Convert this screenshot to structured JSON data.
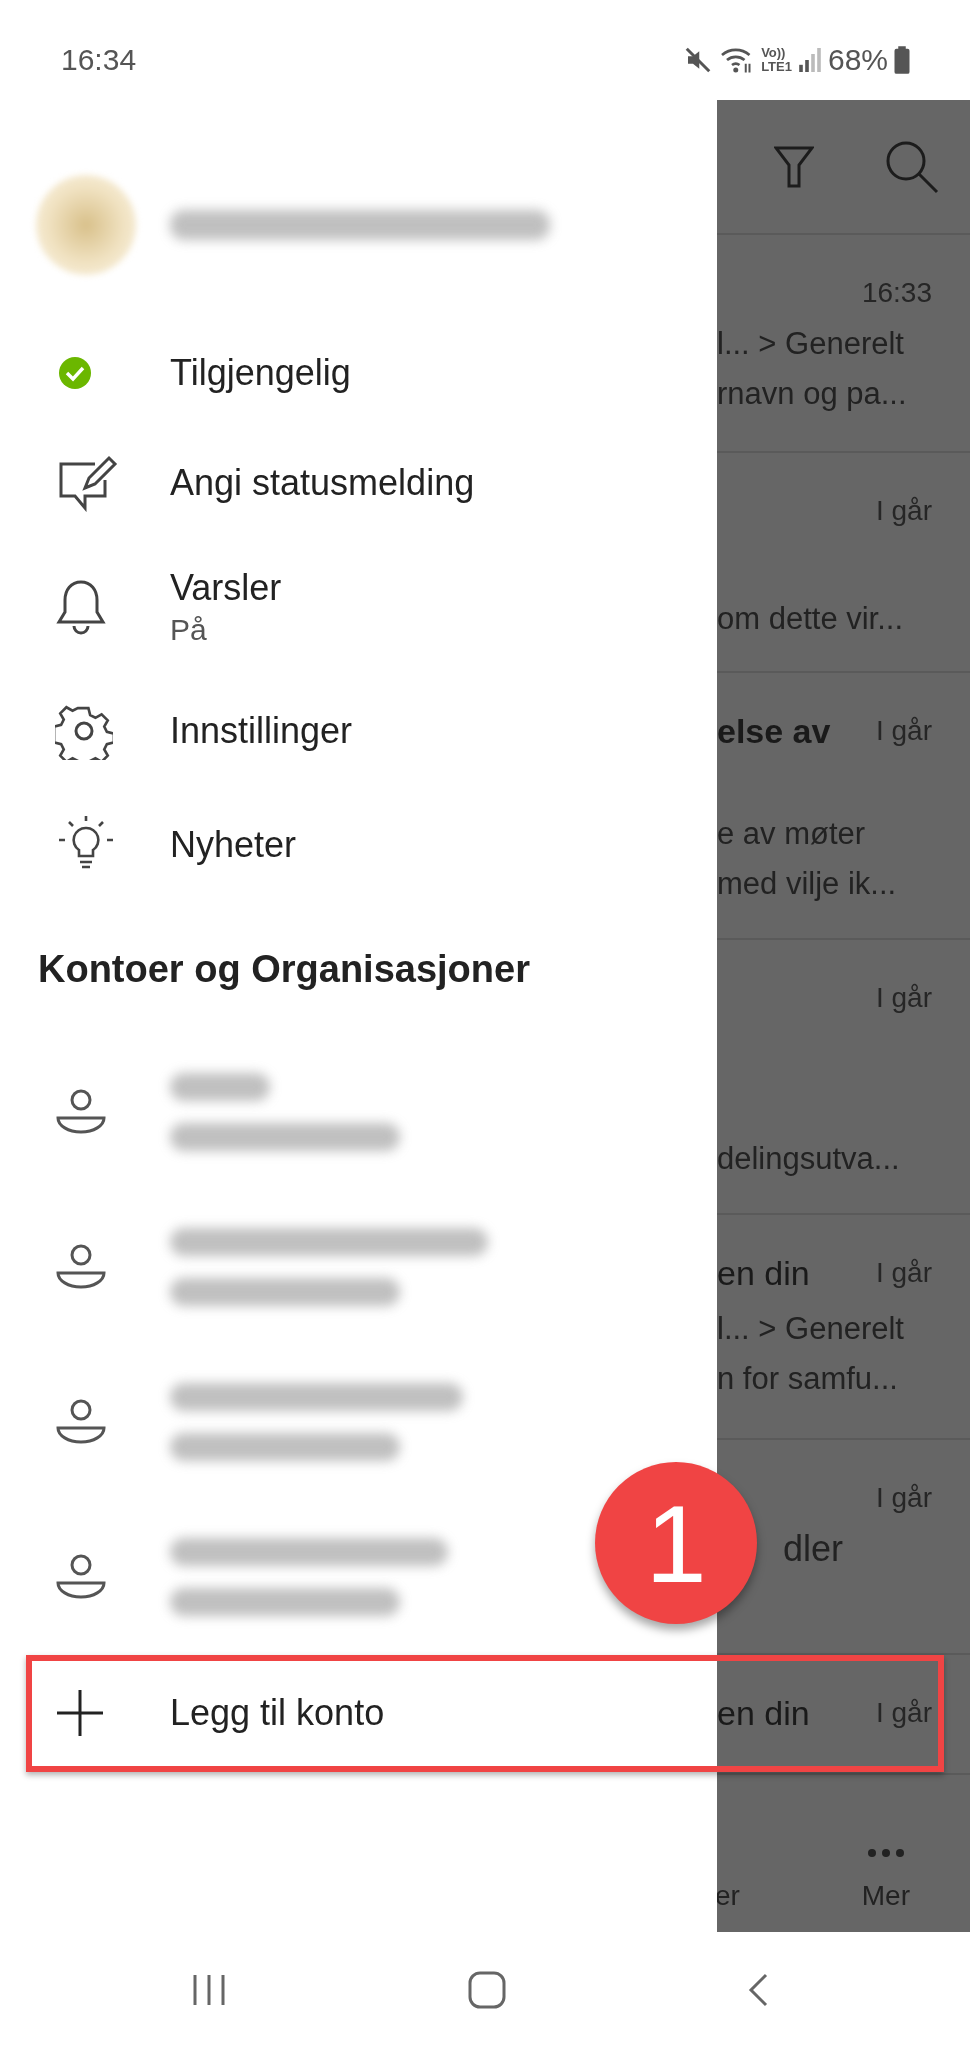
{
  "status_bar": {
    "time": "16:34",
    "network_top": "Vo))",
    "network_bottom": "LTE1",
    "battery": "68%"
  },
  "drawer": {
    "menu": [
      {
        "kind": "presence",
        "label": "Tilgjengelig"
      },
      {
        "kind": "status-message",
        "label": "Angi statusmelding"
      },
      {
        "kind": "notifications",
        "label": "Varsler",
        "sublabel": "På"
      },
      {
        "kind": "settings",
        "label": "Innstillinger"
      },
      {
        "kind": "news",
        "label": "Nyheter"
      }
    ],
    "section_title": "Kontoer og Organisasjoner",
    "accounts": [
      {
        "kind": "redacted"
      },
      {
        "kind": "redacted"
      },
      {
        "kind": "redacted"
      },
      {
        "kind": "redacted"
      }
    ],
    "add_account": "Legg til konto"
  },
  "background_list": {
    "rows": [
      {
        "time": "16:33",
        "lines": [
          "l...  > Generelt",
          "rnavn og pa..."
        ]
      },
      {
        "time": "I går",
        "lines": [
          "om dette vir..."
        ]
      },
      {
        "time": "I går",
        "subject": "else av",
        "lines": [
          "e av møter",
          "med vilje ik..."
        ]
      },
      {
        "time": "I går",
        "lines": [
          "delingsutva..."
        ]
      },
      {
        "time": "I går",
        "subject": "en din",
        "lines": [
          "l...  > Generelt",
          "n for samfu..."
        ]
      },
      {
        "time": "I går",
        "lines": [
          "dler"
        ]
      },
      {
        "time": "I går",
        "subject": "en din",
        "lines": []
      }
    ],
    "bottom_nav": [
      {
        "kind": "label",
        "label": "er"
      },
      {
        "kind": "more",
        "label": "Mer"
      }
    ]
  },
  "annotation": {
    "badge": "1"
  }
}
